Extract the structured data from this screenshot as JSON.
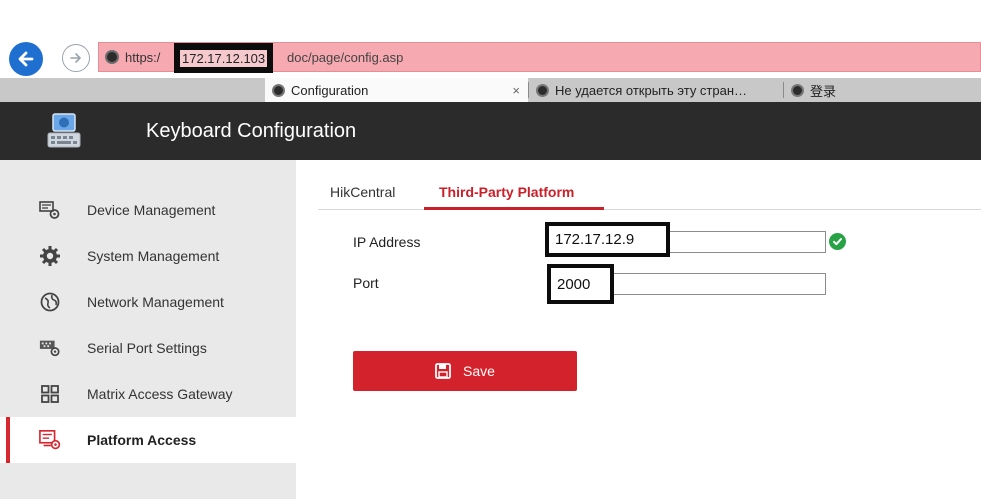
{
  "browser": {
    "url_scheme": "https:/",
    "url_host": "172.17.12.103",
    "url_path": "doc/page/config.asp",
    "tabs": [
      {
        "label": "Configuration",
        "close": "×"
      },
      {
        "label": "Не удается открыть эту стран…"
      },
      {
        "label": "登录"
      }
    ],
    "address_bar_color": "#f6a9b1"
  },
  "app": {
    "title": "Keyboard Configuration",
    "header_color": "#2b2b2b",
    "accent_color": "#d3222b"
  },
  "sidebar": {
    "items": [
      {
        "label": "Device Management",
        "icon": "device-management-icon"
      },
      {
        "label": "System Management",
        "icon": "gear-icon"
      },
      {
        "label": "Network Management",
        "icon": "network-globe-icon"
      },
      {
        "label": "Serial Port Settings",
        "icon": "serial-port-icon"
      },
      {
        "label": "Matrix Access Gateway",
        "icon": "grid-icon"
      },
      {
        "label": "Platform Access",
        "icon": "platform-access-icon",
        "active": true
      }
    ]
  },
  "main": {
    "tabs": [
      {
        "label": "HikCentral"
      },
      {
        "label": "Third-Party Platform",
        "active": true
      }
    ],
    "form": {
      "ip_label": "IP Address",
      "ip_value": "172.17.12.9",
      "port_label": "Port",
      "port_value": "2000"
    },
    "save_label": "Save"
  }
}
